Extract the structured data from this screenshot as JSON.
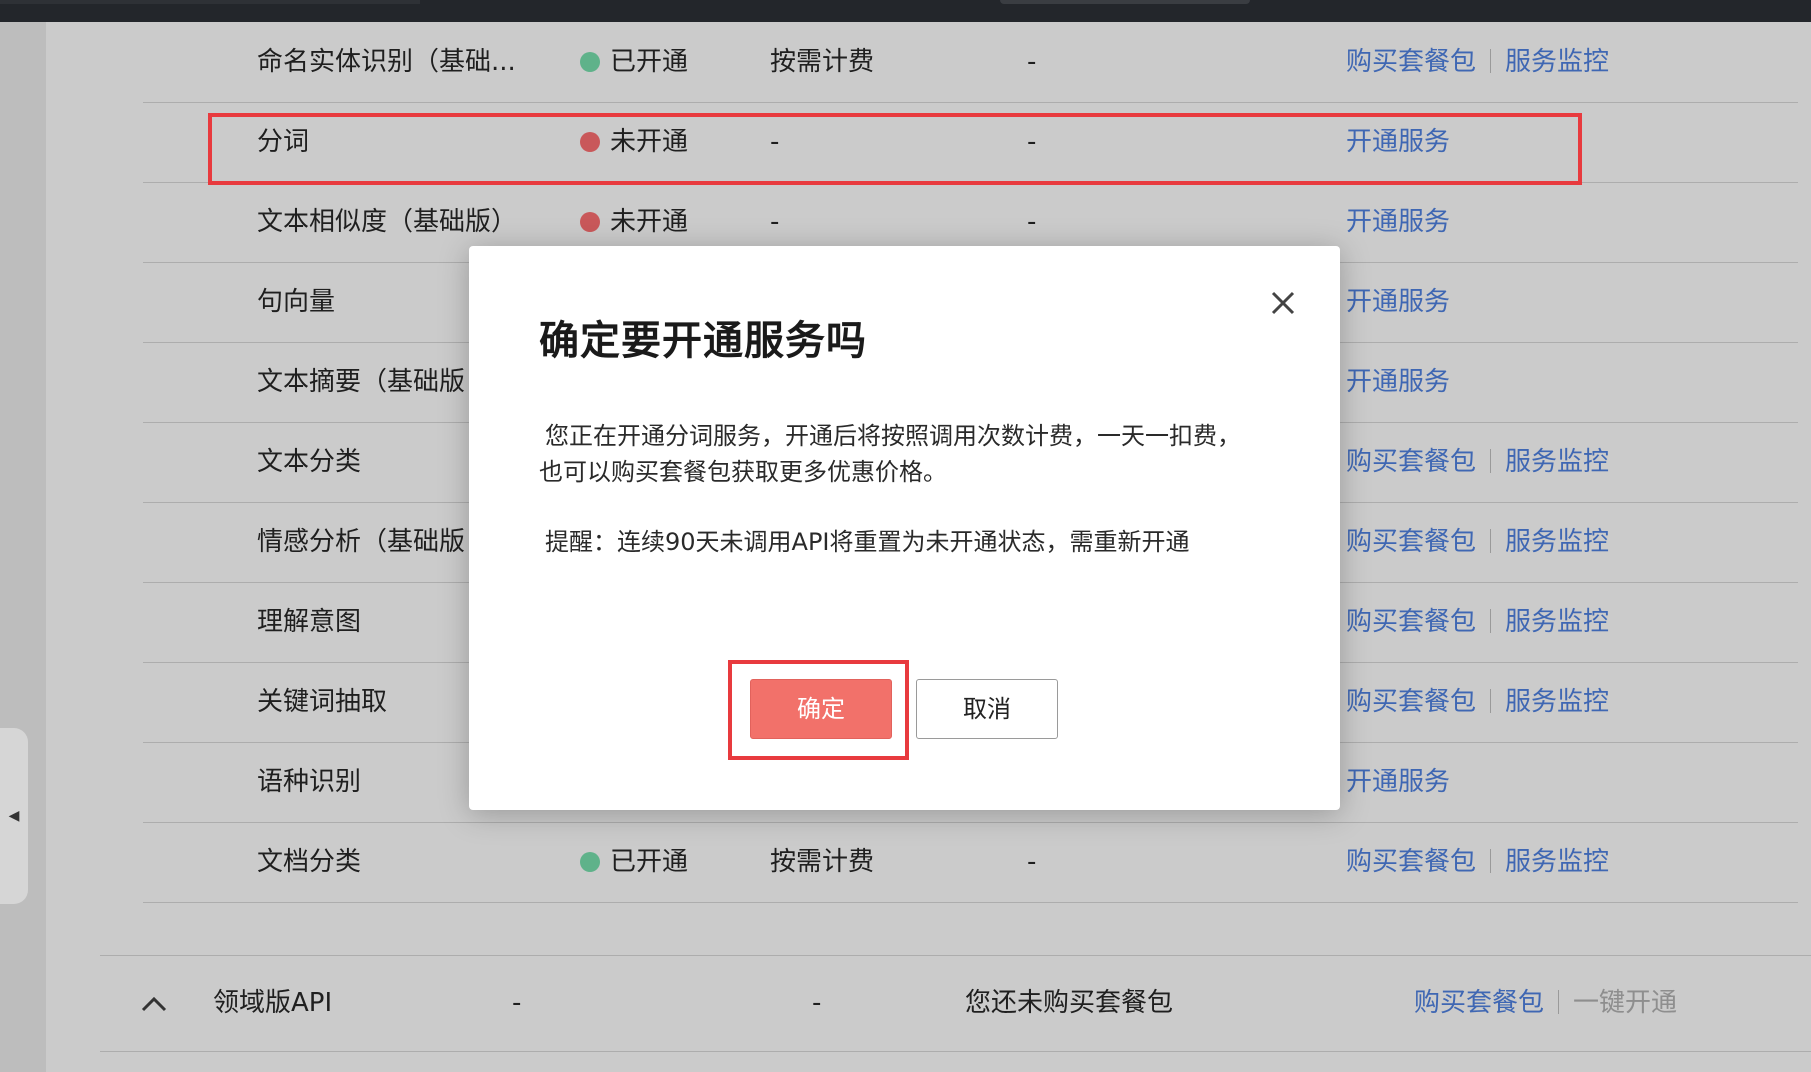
{
  "services": [
    {
      "name": "命名实体识别（基础...",
      "status": "已开通",
      "status_state": "on",
      "billing": "按需计费",
      "package": "-",
      "ops": [
        "购买套餐包",
        "服务监控"
      ]
    },
    {
      "name": "分词",
      "status": "未开通",
      "status_state": "off",
      "billing": "-",
      "package": "-",
      "ops": [
        "开通服务"
      ]
    },
    {
      "name": "文本相似度（基础版）",
      "status": "未开通",
      "status_state": "off",
      "billing": "-",
      "package": "-",
      "ops": [
        "开通服务"
      ]
    },
    {
      "name": "句向量",
      "status": "",
      "status_state": "",
      "billing": "",
      "package": "",
      "ops": [
        "开通服务"
      ]
    },
    {
      "name": "文本摘要（基础版",
      "status": "",
      "status_state": "",
      "billing": "",
      "package": "",
      "ops": [
        "开通服务"
      ]
    },
    {
      "name": "文本分类",
      "status": "",
      "status_state": "",
      "billing": "",
      "package": "",
      "ops": [
        "购买套餐包",
        "服务监控"
      ]
    },
    {
      "name": "情感分析（基础版",
      "status": "",
      "status_state": "",
      "billing": "",
      "package": "",
      "ops": [
        "购买套餐包",
        "服务监控"
      ]
    },
    {
      "name": "理解意图",
      "status": "",
      "status_state": "",
      "billing": "",
      "package": "",
      "ops": [
        "购买套餐包",
        "服务监控"
      ]
    },
    {
      "name": "关键词抽取",
      "status": "",
      "status_state": "",
      "billing": "",
      "package": "",
      "ops": [
        "购买套餐包",
        "服务监控"
      ]
    },
    {
      "name": "语种识别",
      "status": "",
      "status_state": "",
      "billing": "",
      "package": "",
      "ops": [
        "开通服务"
      ]
    },
    {
      "name": "文档分类",
      "status": "已开通",
      "status_state": "on",
      "billing": "按需计费",
      "package": "-",
      "ops": [
        "购买套餐包",
        "服务监控"
      ]
    }
  ],
  "domain_api": {
    "name": "领域版API",
    "col1": "-",
    "col2": "-",
    "package": "您还未购买套餐包",
    "op_buy": "购买套餐包",
    "op_one_click": "一键开通"
  },
  "dialog": {
    "title": "确定要开通服务吗",
    "message": "您正在开通分词服务，开通后将按照调用次数计费，一天一扣费，也可以购买套餐包获取更多优惠价格。",
    "reminder": "提醒：连续90天未调用API将重置为未开通状态，需重新开通",
    "confirm_label": "确定",
    "cancel_label": "取消"
  },
  "colors": {
    "status_on": "#5fb28a",
    "status_off": "#c9585a",
    "link": "#3f67b3",
    "highlight": "#e83a3e",
    "confirm_button": "#f2716a"
  },
  "icons": {
    "close": "close-icon",
    "collapse": "caret-left-icon",
    "expand_toggle": "chevron-up-icon"
  }
}
